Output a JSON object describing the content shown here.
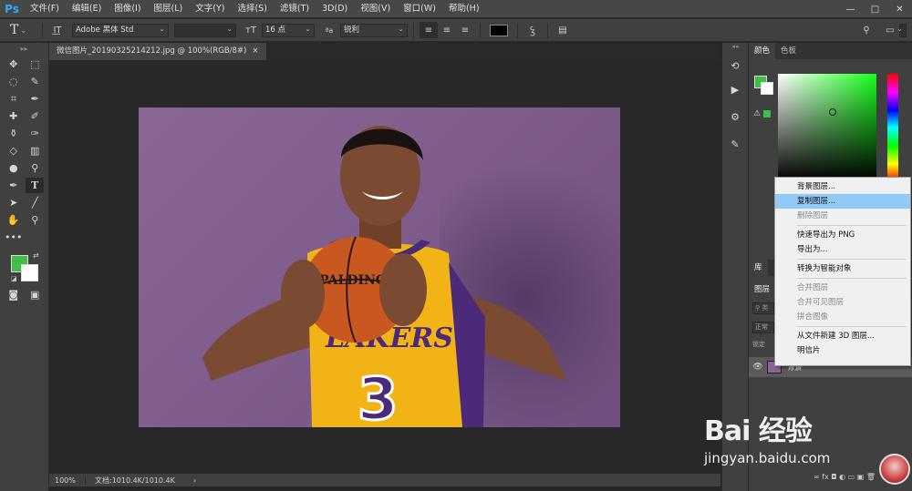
{
  "app": {
    "logo": "Ps"
  },
  "menu": [
    "文件(F)",
    "编辑(E)",
    "图像(I)",
    "图层(L)",
    "文字(Y)",
    "选择(S)",
    "滤镜(T)",
    "3D(D)",
    "视图(V)",
    "窗口(W)",
    "帮助(H)"
  ],
  "window_controls": {
    "minimize": "—",
    "maximize": "□",
    "close": "✕"
  },
  "options": {
    "font_family": "Adobe 黑体 Std",
    "font_size": "16 点",
    "aa_label": "ªa",
    "antialias": "锐利",
    "text_color": "#000000"
  },
  "document": {
    "tab_title": "微信图片_20190325214212.jpg @ 100%(RGB/8#)",
    "close": "×"
  },
  "status": {
    "zoom": "100%",
    "doc_size": "文档:1010.4K/1010.4K",
    "more": "›"
  },
  "colors": {
    "foreground": "#3fbf4a",
    "background": "#ffffff"
  },
  "panels": {
    "color_tab": "颜色",
    "swatches_tab": "色板",
    "library_tab": "库",
    "layers_tab": "图层",
    "search_placeholder": "类",
    "blend_mode": "正常",
    "lock_label": "锁定",
    "layer_name": "背景",
    "footer_icons": "∞  fx  ◘  ◐  ▭  ▣  🗑"
  },
  "context_menu": {
    "items": [
      {
        "label": "背景图层...",
        "disabled": false
      },
      {
        "label": "复制图层...",
        "disabled": false,
        "hover": true
      },
      {
        "label": "删除图层",
        "disabled": true
      },
      {
        "sep": true
      },
      {
        "label": "快速导出为 PNG",
        "disabled": false
      },
      {
        "label": "导出为...",
        "disabled": false
      },
      {
        "sep": true
      },
      {
        "label": "转换为智能对象",
        "disabled": false
      },
      {
        "sep": true
      },
      {
        "label": "合并图层",
        "disabled": true
      },
      {
        "label": "合并可见图层",
        "disabled": true
      },
      {
        "label": "拼合图像",
        "disabled": true
      },
      {
        "sep": true
      },
      {
        "label": "从文件新建 3D 图层...",
        "disabled": false
      },
      {
        "label": "明信片",
        "disabled": false
      }
    ]
  },
  "photo": {
    "ball_brand": "SPALDING",
    "jersey_text": "LAKERS",
    "jersey_number": "3"
  },
  "watermark": {
    "logo": "Bai 经验",
    "url": "jingyan.baidu.com"
  }
}
